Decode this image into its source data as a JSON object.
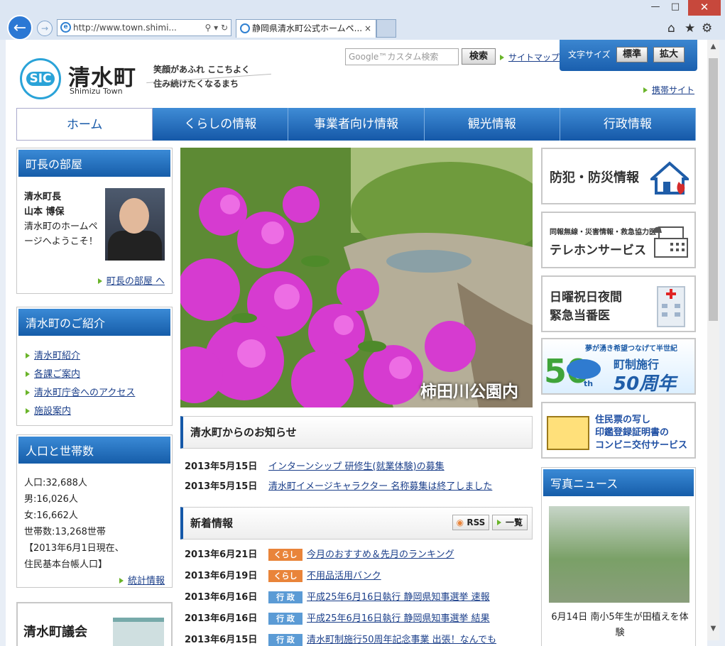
{
  "browser": {
    "window_controls": {
      "minimize": "—",
      "maximize": "□",
      "close": "✕"
    },
    "address": "http://www.town.shimi...",
    "tab_title": "静岡県清水町公式ホームペ...",
    "tab_close": "×"
  },
  "header": {
    "logo_mark": "SIC",
    "town_name": "清水町",
    "town_name_en": "Shimizu Town",
    "slogan_line1": "笑顔があふれ ここちよく",
    "slogan_line2": "住み続けたくなるまち",
    "search_placeholder": "Google™カスタム検索",
    "search_button": "検索",
    "sitemap": "サイトマップ",
    "font_size_label": "文字サイズ",
    "font_standard": "標準",
    "font_large": "拡大",
    "mobile_site": "携帯サイト"
  },
  "nav": [
    "ホーム",
    "くらしの情報",
    "事業者向け情報",
    "観光情報",
    "行政情報"
  ],
  "mayor": {
    "title": "町長の部屋",
    "line1": "清水町長",
    "line2": "山本 博保",
    "line3": "清水町のホームページへようこそ！",
    "link": "町長の部屋 へ"
  },
  "intro": {
    "title": "清水町のご紹介",
    "items": [
      "清水町紹介",
      "各課ご案内",
      "清水町庁舎へのアクセス",
      "施設案内"
    ]
  },
  "population": {
    "title": "人口と世帯数",
    "lines": [
      "人口:32,688人",
      "男:16,026人",
      "女:16,662人",
      "世帯数:13,268世帯",
      "【2013年6月1日現在、",
      "住民基本台帳人口】"
    ],
    "link": "統計情報"
  },
  "council": {
    "title": "清水町議会"
  },
  "hero": {
    "caption": "柿田川公園内"
  },
  "notices": {
    "title": "清水町からのお知らせ",
    "items": [
      {
        "date": "2013年5月15日",
        "text": "インターンシップ 研修生(就業体験)の募集"
      },
      {
        "date": "2013年5月15日",
        "text": "清水町イメージキャラクター 名称募集は終了しました"
      }
    ]
  },
  "news": {
    "title": "新着情報",
    "rss": "RSS",
    "list": "一覧",
    "items": [
      {
        "date": "2013年6月21日",
        "tag": "くらし",
        "text": "今月のおすすめ＆先月のランキング"
      },
      {
        "date": "2013年6月19日",
        "tag": "くらし",
        "text": "不用品活用バンク"
      },
      {
        "date": "2013年6月16日",
        "tag": "行 政",
        "text": "平成25年6月16日執行 静岡県知事選挙 速報"
      },
      {
        "date": "2013年6月16日",
        "tag": "行 政",
        "text": "平成25年6月16日執行 静岡県知事選挙 結果"
      },
      {
        "date": "2013年6月15日",
        "tag": "行 政",
        "text": "清水町制施行50周年記念事業 出張！なんでも"
      }
    ]
  },
  "banners": {
    "b1": "防犯・防災情報",
    "b2_small": "同報無線・災害情報・救急協力医",
    "b2_big": "テレホンサービス",
    "b3_l1": "日曜祝日夜間",
    "b3_l2": "緊急当番医",
    "b4_top": "夢が湧き希望つなげて半世紀",
    "b4_l1": "町制施行",
    "b4_l2": "50周年",
    "b4_num": "50",
    "b4_th": "th",
    "b5_l1": "住民票の写し",
    "b5_l2": "印鑑登録証明書の",
    "b5_l3": "コンビニ交付サービス"
  },
  "photo_news": {
    "title": "写真ニュース",
    "caption": "6月14日 南小5年生が田植えを体験"
  }
}
